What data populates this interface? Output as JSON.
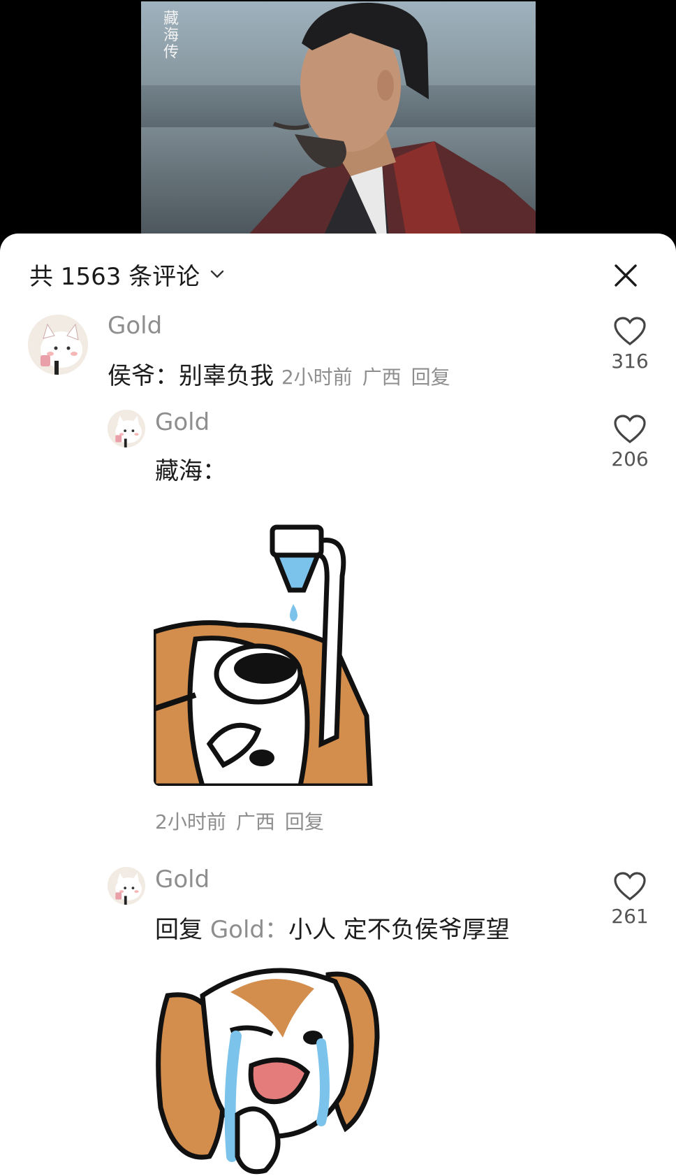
{
  "video": {
    "watermark": "藏海传"
  },
  "sheet": {
    "title": "共 1563 条评论"
  },
  "comments": [
    {
      "username": "Gold",
      "text": "侯爷：别辜负我",
      "time": "2小时前",
      "location": "广西",
      "reply_label": "回复",
      "likes": "316"
    },
    {
      "username": "Gold",
      "text": "藏海：",
      "time": "2小时前",
      "location": "广西",
      "reply_label": "回复",
      "likes": "206"
    },
    {
      "username": "Gold",
      "reply_prefix": "回复",
      "reply_target": "Gold：",
      "text": "小人 定不负侯爷厚望",
      "likes": "261"
    }
  ],
  "colors": {
    "accent_brown": "#c98a4a",
    "blue_drop": "#7cc3ec"
  }
}
